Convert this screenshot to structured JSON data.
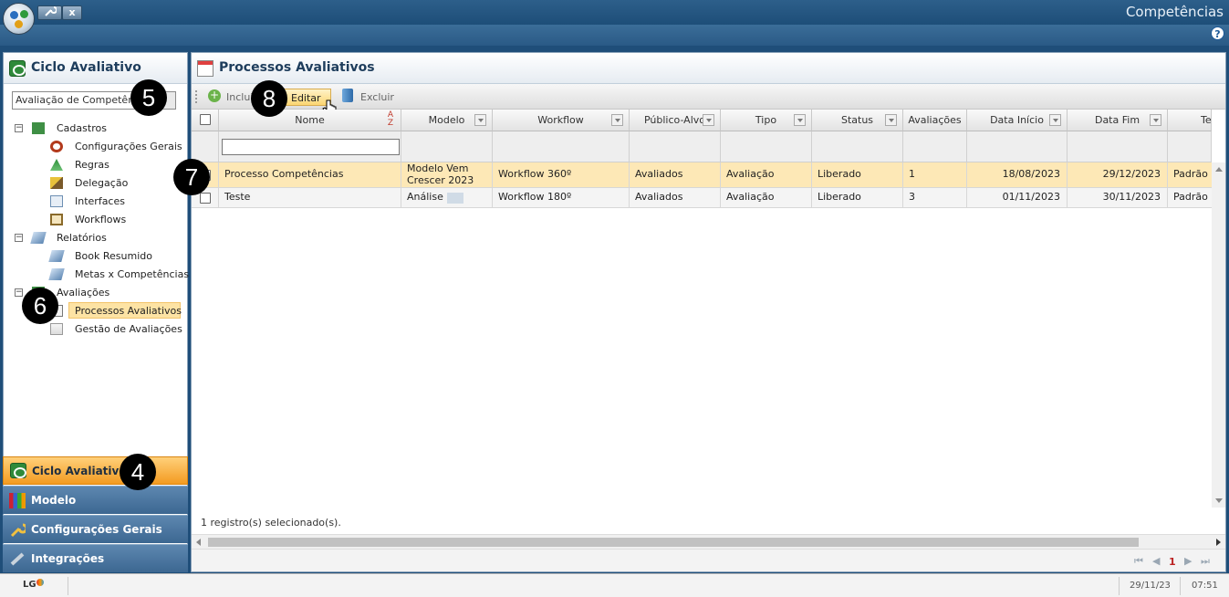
{
  "app": {
    "title": "Competências",
    "tab_close": "x",
    "help": "?"
  },
  "left_panel": {
    "title": "Ciclo Avaliativo",
    "combo_value": "Avaliação de Competências",
    "tree": [
      {
        "label": "Cadastros",
        "type": "group",
        "expanded": "−"
      },
      {
        "label": "Configurações Gerais",
        "type": "item"
      },
      {
        "label": "Regras",
        "type": "item"
      },
      {
        "label": "Delegação",
        "type": "item"
      },
      {
        "label": "Interfaces",
        "type": "item"
      },
      {
        "label": "Workflows",
        "type": "item"
      },
      {
        "label": "Relatórios",
        "type": "group",
        "expanded": "−"
      },
      {
        "label": "Book Resumido",
        "type": "item"
      },
      {
        "label": "Metas x Competências",
        "type": "item"
      },
      {
        "label": "Avaliações",
        "type": "group",
        "expanded": "−"
      },
      {
        "label": "Processos Avaliativos",
        "type": "item",
        "selected": true
      },
      {
        "label": "Gestão de Avaliações",
        "type": "item"
      }
    ]
  },
  "accordion": [
    {
      "label": "Ciclo Avaliativo",
      "active": true
    },
    {
      "label": "Modelo"
    },
    {
      "label": "Configurações Gerais"
    },
    {
      "label": "Integrações"
    }
  ],
  "main": {
    "title": "Processos Avaliativos",
    "toolbar": {
      "include": "Incluir",
      "edit": "Editar",
      "delete": "Excluir"
    },
    "columns": [
      "Nome",
      "Modelo",
      "Workflow",
      "Público-Alvo",
      "Tipo",
      "Status",
      "Avaliações",
      "Data Início",
      "Data Fim",
      "Templa"
    ],
    "rows": [
      {
        "nome": "Processo Competências",
        "modelo": "Modelo Vem Crescer 2023",
        "workflow": "Workflow 360º",
        "publico": "Avaliados",
        "tipo": "Avaliação",
        "status": "Liberado",
        "avaliacoes": "1",
        "inicio": "18/08/2023",
        "fim": "29/12/2023",
        "template": "Padrão"
      },
      {
        "nome": "Teste",
        "modelo": "Análise",
        "workflow": "Workflow 180º",
        "publico": "Avaliados",
        "tipo": "Avaliação",
        "status": "Liberado",
        "avaliacoes": "3",
        "inicio": "01/11/2023",
        "fim": "30/11/2023",
        "template": "Padrão L"
      }
    ],
    "selection_text": "1 registro(s) selecionado(s).",
    "page": "1"
  },
  "status_bar": {
    "logo": "LG",
    "date": "29/11/23",
    "time": "07:51"
  },
  "badges": [
    "4",
    "5",
    "6",
    "7",
    "8"
  ],
  "colors": {
    "accent_orange": "#f39b21",
    "header_blue": "#1d4d78",
    "selected_row": "#fde8b6"
  }
}
